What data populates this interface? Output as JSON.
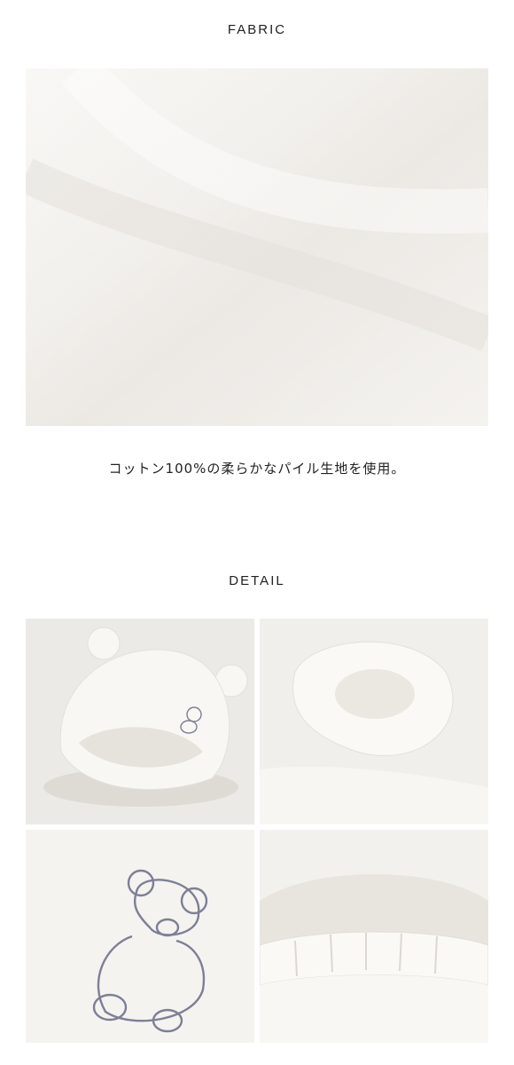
{
  "fabric": {
    "heading": "FABRIC",
    "caption": "コットン100%の柔らかなパイル生地を使用。"
  },
  "detail": {
    "heading": "DETAIL"
  },
  "colors": {
    "towel": "#f6f4f0",
    "shadow": "#dcd8d1",
    "embroidery": "#7d7f96"
  }
}
